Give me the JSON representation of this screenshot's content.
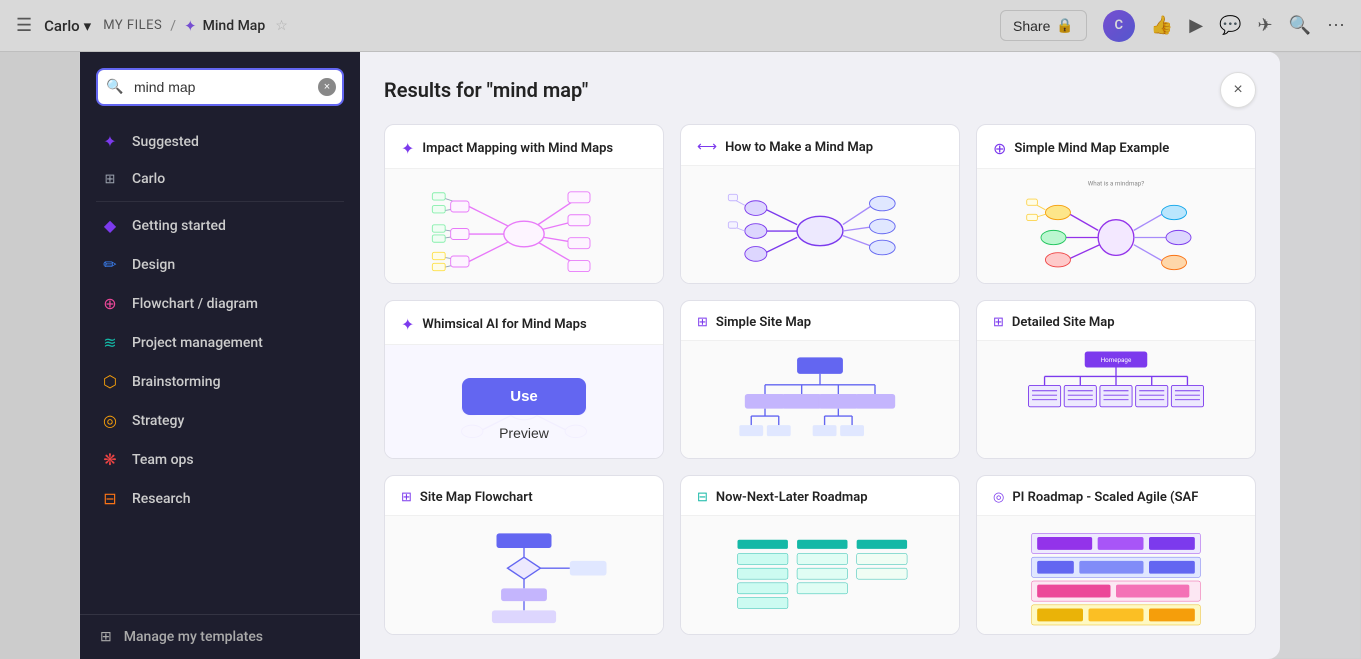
{
  "nav": {
    "menu_icon": "☰",
    "workspace": "Carlo",
    "workspace_caret": "▾",
    "breadcrumb_files": "MY FILES",
    "breadcrumb_sep": "/",
    "mindmap_icon": "✦",
    "mindmap_label": "Mind Map",
    "star_icon": "☆",
    "more_icon": "•••",
    "share_label": "Share",
    "lock_icon": "🔒"
  },
  "search": {
    "placeholder": "mind map",
    "query": "mind map"
  },
  "categories": [
    {
      "id": "suggested",
      "label": "Suggested",
      "icon": "✦",
      "color": "purple"
    },
    {
      "id": "carlo",
      "label": "Carlo",
      "icon": "⊞",
      "color": "gray"
    },
    {
      "id": "getting-started",
      "label": "Getting started",
      "icon": "◆",
      "color": "purple"
    },
    {
      "id": "design",
      "label": "Design",
      "icon": "✏",
      "color": "blue"
    },
    {
      "id": "flowchart",
      "label": "Flowchart / diagram",
      "icon": "⊕",
      "color": "pink"
    },
    {
      "id": "project-management",
      "label": "Project management",
      "icon": "≋",
      "color": "teal"
    },
    {
      "id": "brainstorming",
      "label": "Brainstorming",
      "icon": "⬡",
      "color": "yellow"
    },
    {
      "id": "strategy",
      "label": "Strategy",
      "icon": "◎",
      "color": "yellow"
    },
    {
      "id": "team-ops",
      "label": "Team ops",
      "icon": "❋",
      "color": "red"
    },
    {
      "id": "research",
      "label": "Research",
      "icon": "⊟",
      "color": "orange"
    }
  ],
  "manage_templates_label": "Manage my templates",
  "results": {
    "title": "Results for \"mind map\"",
    "close_label": "×",
    "cards": [
      {
        "id": "impact-mapping",
        "title": "Impact Mapping with Mind Maps",
        "icon": "✦",
        "icon_color": "purple",
        "type": "mindmap-impact"
      },
      {
        "id": "how-to-mind-map",
        "title": "How to Make a Mind Map",
        "icon": "⟷",
        "icon_color": "purple",
        "type": "mindmap-how"
      },
      {
        "id": "simple-mind-map",
        "title": "Simple Mind Map Example",
        "icon": "⊕",
        "icon_color": "purple",
        "type": "mindmap-simple"
      },
      {
        "id": "whimsical-ai",
        "title": "Whimsical AI for Mind Maps",
        "icon": "✦",
        "icon_color": "purple",
        "type": "ai-mindmap",
        "featured": true,
        "use_label": "Use",
        "preview_label": "Preview"
      },
      {
        "id": "simple-site-map",
        "title": "Simple Site Map",
        "icon": "⊞",
        "icon_color": "purple",
        "type": "sitemap-simple"
      },
      {
        "id": "detailed-site-map",
        "title": "Detailed Site Map",
        "icon": "⊞",
        "icon_color": "purple",
        "type": "sitemap-detailed"
      },
      {
        "id": "site-map-flowchart",
        "title": "Site Map Flowchart",
        "icon": "⊞",
        "icon_color": "purple",
        "type": "sitemap-flowchart"
      },
      {
        "id": "now-next-later",
        "title": "Now-Next-Later Roadmap",
        "icon": "⊟",
        "icon_color": "teal",
        "type": "roadmap"
      },
      {
        "id": "pi-roadmap",
        "title": "PI Roadmap - Scaled Agile (SAF",
        "icon": "◎",
        "icon_color": "purple",
        "type": "pi-roadmap"
      }
    ]
  }
}
